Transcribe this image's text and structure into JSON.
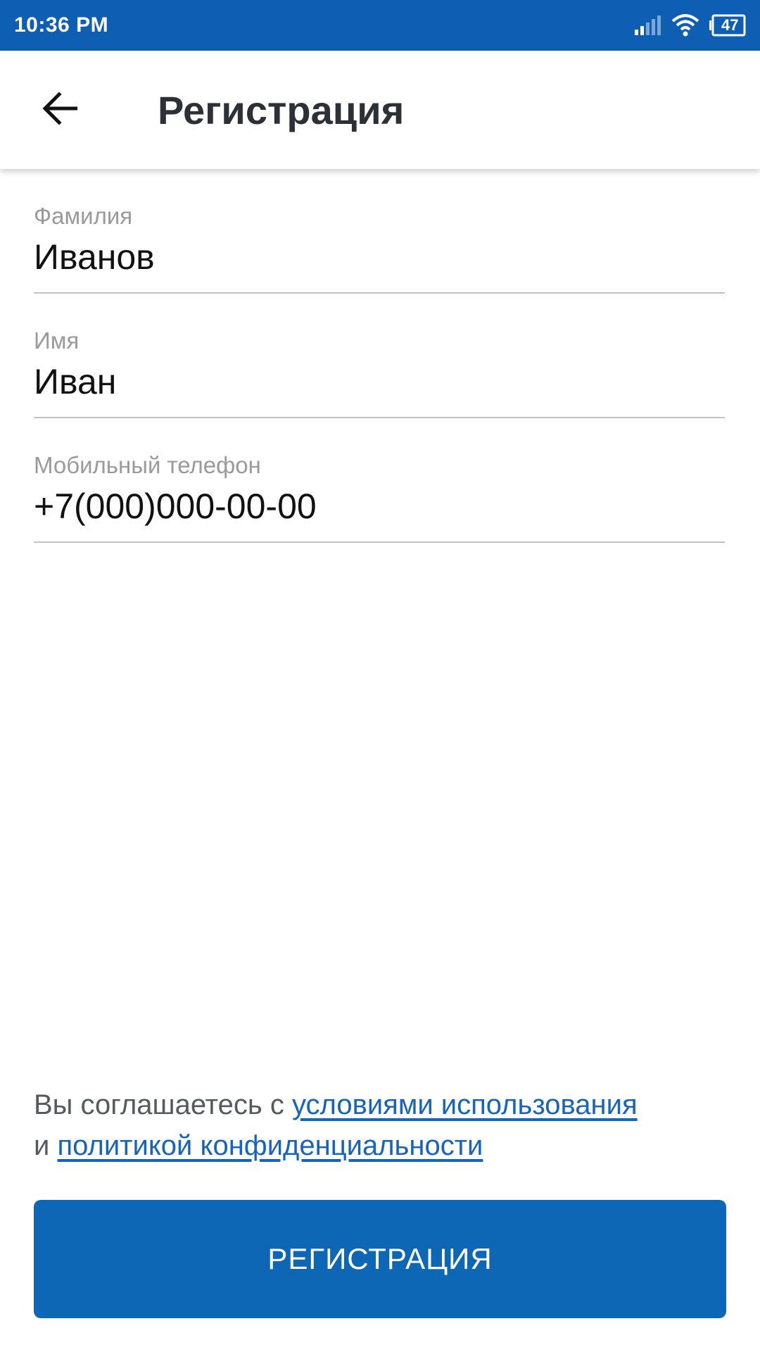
{
  "status_bar": {
    "time": "10:36 PM",
    "battery": "47",
    "icons": [
      "signal-icon",
      "wifi-icon",
      "battery-icon"
    ]
  },
  "app_bar": {
    "back_icon": "back-arrow-icon",
    "title": "Регистрация"
  },
  "form": {
    "last_name": {
      "label": "Фамилия",
      "value": "Иванов"
    },
    "first_name": {
      "label": "Имя",
      "value": "Иван"
    },
    "phone": {
      "label": "Мобильный телефон",
      "value": "+7(000)000-00-00"
    }
  },
  "terms": {
    "prefix": "Вы соглашаетесь с ",
    "terms_link": "условиями использования",
    "connector": "и ",
    "privacy_link": "политикой конфиденциальности"
  },
  "register_button": {
    "label": "РЕГИСТРАЦИЯ"
  },
  "colors": {
    "primary": "#0e67b4",
    "status_bar": "#0e5fb3",
    "link": "#1565c0",
    "title": "#2c3138",
    "label": "#9a9a9a"
  }
}
